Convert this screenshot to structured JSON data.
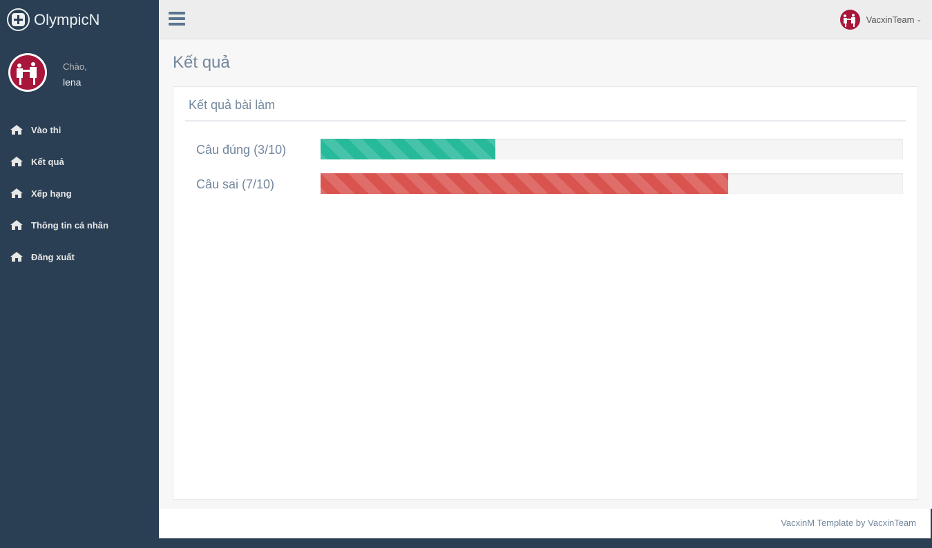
{
  "brand": {
    "name": "OlympicN"
  },
  "profile": {
    "greeting": "Chào,",
    "username": "lena"
  },
  "sidebar": {
    "items": [
      {
        "label": "Vào thi",
        "icon": "home-icon"
      },
      {
        "label": "Kết quả",
        "icon": "home-icon"
      },
      {
        "label": "Xếp hạng",
        "icon": "home-icon"
      },
      {
        "label": "Thông tin cá nhân",
        "icon": "home-icon"
      },
      {
        "label": "Đăng xuất",
        "icon": "home-icon"
      }
    ]
  },
  "topnav": {
    "menu_icon": "hamburger-icon",
    "user_name": "VacxinTeam",
    "chevron": "⌄"
  },
  "page": {
    "title": "Kết quả"
  },
  "panel": {
    "title": "Kết quả bài làm",
    "stats": [
      {
        "label": "Câu đúng (3/10)",
        "fraction": 0.3,
        "color": "#26b99a"
      },
      {
        "label": "Câu sai (7/10)",
        "fraction": 0.7,
        "color": "#d9534f"
      }
    ]
  },
  "footer": {
    "text": "VacxinM Template by VacxinTeam"
  },
  "colors": {
    "sidebar_bg": "#2a3f54",
    "accent_text": "#73879c",
    "success": "#26b99a",
    "danger": "#d9534f"
  }
}
